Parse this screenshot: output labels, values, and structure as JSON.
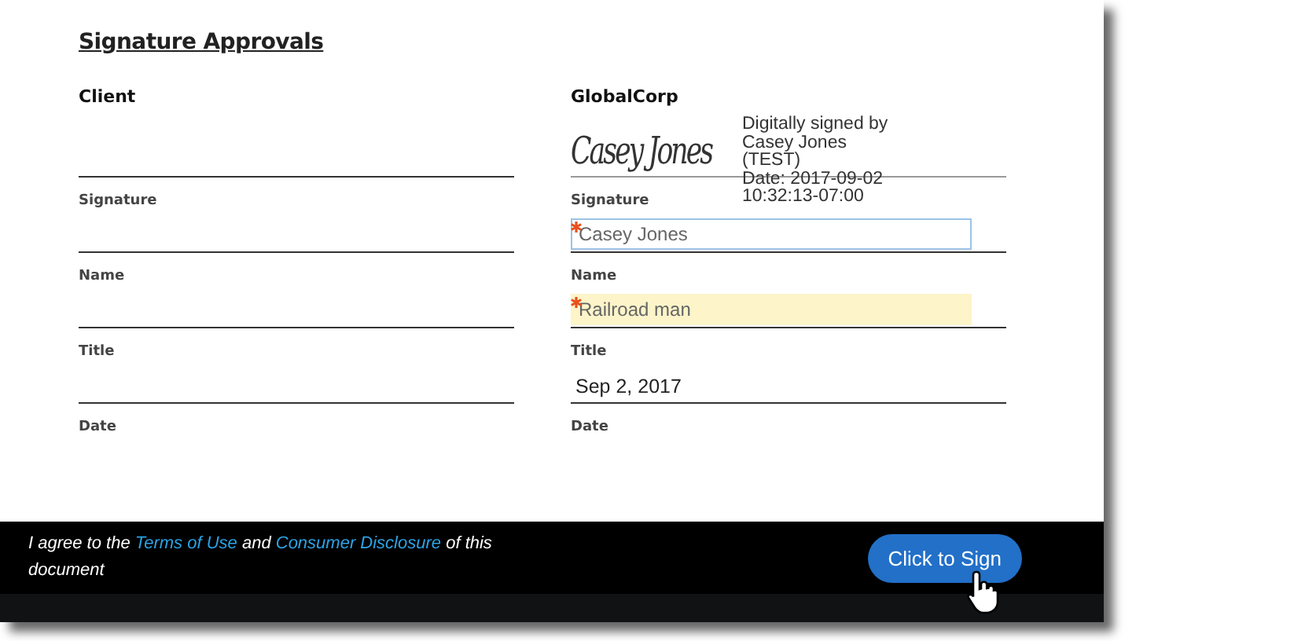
{
  "title": "Signature Approvals",
  "columns": [
    {
      "heading": "Client",
      "rows": [
        {
          "kind": "blank",
          "label": "Signature"
        },
        {
          "kind": "blank",
          "label": "Name"
        },
        {
          "kind": "blank",
          "label": "Title"
        },
        {
          "kind": "blank",
          "label": "Date"
        }
      ]
    },
    {
      "heading": "GlobalCorp",
      "rows": [
        {
          "kind": "signature",
          "signature": "Casey Jones",
          "stamp": [
            "Digitally signed by",
            "Casey Jones",
            "(TEST)",
            "Date: 2017-09-02",
            "10:32:13-07:00"
          ],
          "label": "Signature"
        },
        {
          "kind": "field",
          "value": "Casey Jones",
          "required": true,
          "focused": true,
          "label": "Name"
        },
        {
          "kind": "field",
          "value": "Railroad man",
          "required": true,
          "focused": false,
          "label": "Title"
        },
        {
          "kind": "text",
          "value": "Sep 2, 2017",
          "label": "Date"
        }
      ]
    }
  ],
  "footer": {
    "agreement": [
      {
        "kind": "text",
        "text": "I agree to the "
      },
      {
        "kind": "link",
        "text": "Terms of Use"
      },
      {
        "kind": "text",
        "text": " and "
      },
      {
        "kind": "link",
        "text": "Consumer Disclosure"
      },
      {
        "kind": "text",
        "text": " of this document"
      }
    ],
    "button": "Click to Sign"
  }
}
